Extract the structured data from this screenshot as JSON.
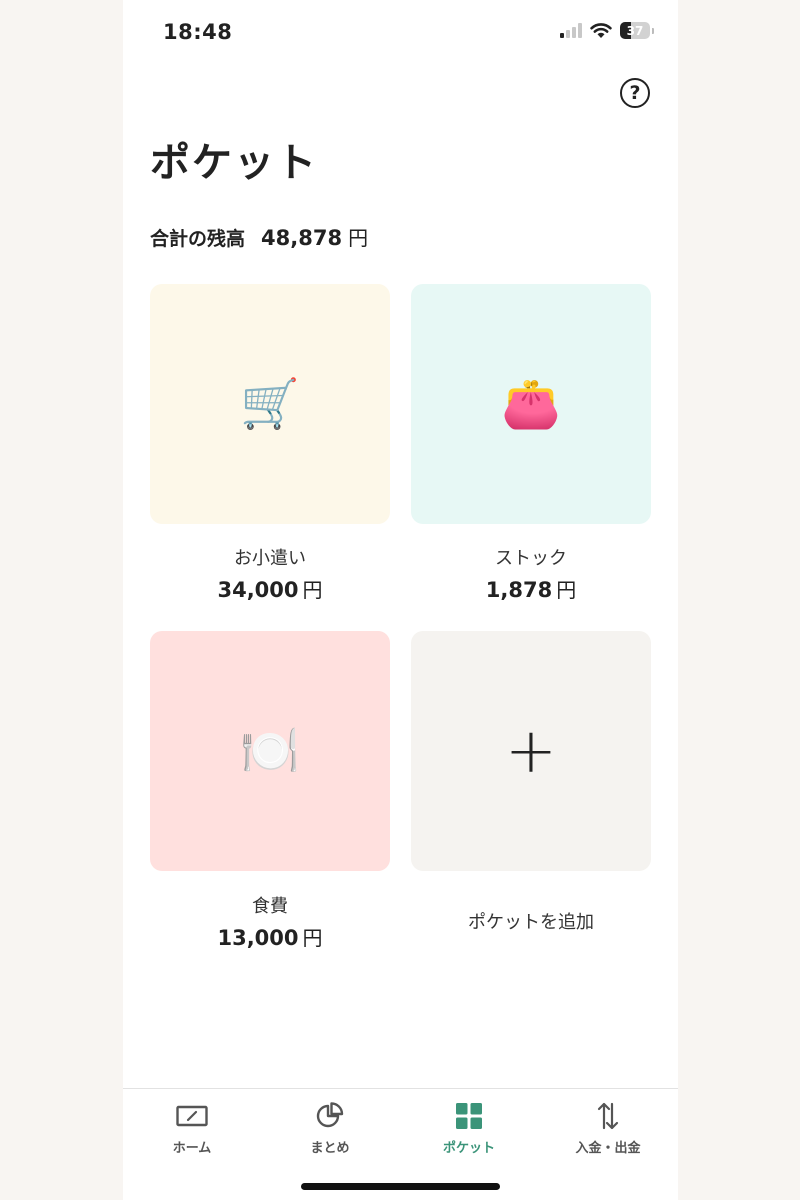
{
  "status_bar": {
    "time": "18:48",
    "battery": "37"
  },
  "header": {
    "title": "ポケット",
    "help_icon": "question-circle-icon"
  },
  "total": {
    "label": "合計の残高",
    "amount": "48,878",
    "currency": "円"
  },
  "pockets": [
    {
      "name": "お小遣い",
      "amount": "34,000",
      "currency": "円",
      "icon": "🛒",
      "icon_name": "shopping-cart-icon",
      "bg": "#fdf8e9"
    },
    {
      "name": "ストック",
      "amount": "1,878",
      "currency": "円",
      "icon": "👛",
      "icon_name": "purse-icon",
      "bg": "#e7f8f5"
    },
    {
      "name": "食費",
      "amount": "13,000",
      "currency": "円",
      "icon": "🍽️",
      "icon_name": "plate-cutlery-icon",
      "bg": "#ffe0de"
    }
  ],
  "add_pocket": {
    "icon": "+",
    "label": "ポケットを追加",
    "bg": "#f5f3f0"
  },
  "tabs": [
    {
      "label": "ホーム",
      "icon": "home-screen-icon"
    },
    {
      "label": "まとめ",
      "icon": "pie-chart-icon"
    },
    {
      "label": "ポケット",
      "icon": "grid-icon",
      "active": true
    },
    {
      "label": "入金・出金",
      "icon": "transfer-arrows-icon"
    }
  ],
  "colors": {
    "accent": "#3b9479",
    "text": "#222222"
  }
}
